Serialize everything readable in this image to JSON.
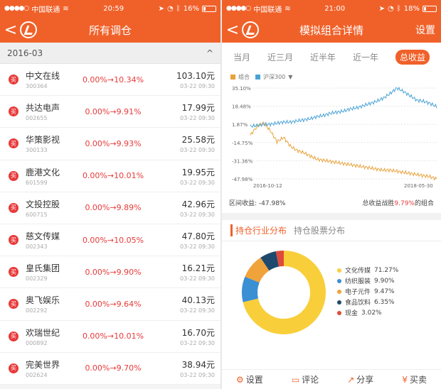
{
  "left": {
    "status": {
      "carrier": "中国联通",
      "time": "20:59",
      "battery": "16%",
      "battery_level": 0.16
    },
    "nav": {
      "title": "所有调仓",
      "back": "<"
    },
    "section": {
      "label": "2016-03",
      "toggle": "^"
    },
    "badge": "买",
    "rows": [
      {
        "name": "中文在线",
        "code": "300364",
        "change": "0.00%→10.34%",
        "price": "103.10元",
        "time": "03-22 09:30"
      },
      {
        "name": "共达电声",
        "code": "002655",
        "change": "0.00%→9.91%",
        "price": "17.99元",
        "time": "03-22 09:30"
      },
      {
        "name": "华策影视",
        "code": "300133",
        "change": "0.00%→9.93%",
        "price": "25.58元",
        "time": "03-22 09:30"
      },
      {
        "name": "鹿港文化",
        "code": "601599",
        "change": "0.00%→10.01%",
        "price": "19.95元",
        "time": "03-22 09:30"
      },
      {
        "name": "文投控股",
        "code": "600715",
        "change": "0.00%→9.89%",
        "price": "42.96元",
        "time": "03-22 09:30"
      },
      {
        "name": "慈文传媒",
        "code": "002343",
        "change": "0.00%→10.05%",
        "price": "47.80元",
        "time": "03-22 09:30"
      },
      {
        "name": "皇氏集团",
        "code": "002329",
        "change": "0.00%→9.90%",
        "price": "16.21元",
        "time": "03-22 09:30"
      },
      {
        "name": "奥飞娱乐",
        "code": "002292",
        "change": "0.00%→9.64%",
        "price": "40.13元",
        "time": "03-22 09:30"
      },
      {
        "name": "欢瑞世纪",
        "code": "000892",
        "change": "0.00%→10.01%",
        "price": "16.70元",
        "time": "03-22 09:30"
      },
      {
        "name": "完美世界",
        "code": "002624",
        "change": "0.00%→9.70%",
        "price": "38.94元",
        "time": "03-22 09:30"
      }
    ]
  },
  "right": {
    "status": {
      "carrier": "中国联通",
      "time": "21:00",
      "battery": "18%",
      "battery_level": 0.18
    },
    "nav": {
      "title": "模拟组合详情",
      "back": "<",
      "settings": "设置"
    },
    "period_tabs": [
      "当月",
      "近三月",
      "近半年",
      "近一年",
      "总收益"
    ],
    "legend": {
      "portfolio": "组合",
      "index": "沪深300",
      "arrow": "▼"
    },
    "summary": {
      "label": "区间收益:",
      "value": "-47.98%",
      "prefix": "总收益战胜",
      "pct": "9.79%",
      "suffix": "的组合"
    },
    "dist_tabs": [
      "持仓行业分布",
      "持仓股票分布"
    ],
    "bottom": [
      {
        "icon": "gear-icon",
        "glyph": "⚙",
        "label": "设置"
      },
      {
        "icon": "comment-icon",
        "glyph": "▭",
        "label": "评论"
      },
      {
        "icon": "share-icon",
        "glyph": "↗",
        "label": "分享"
      },
      {
        "icon": "yen-icon",
        "glyph": "¥",
        "label": "买卖"
      }
    ]
  },
  "chart_data": [
    {
      "type": "line",
      "y_ticks": [
        "35.10%",
        "18.48%",
        "1.87%",
        "-14.75%",
        "-31.36%",
        "-47.98%"
      ],
      "ylim": [
        -47.98,
        35.1
      ],
      "x_ticks": [
        "2016-10-12",
        "2018-05-30"
      ],
      "grid": true,
      "legend": "top-left",
      "series": [
        {
          "name": "组合",
          "color": "#e8a23c",
          "values": [
            -8,
            0,
            3,
            -4,
            -14,
            -10,
            -18,
            -22,
            -24,
            -27,
            -30,
            -31,
            -32,
            -33,
            -34,
            -35,
            -36,
            -37,
            -38,
            -39,
            -40,
            -40,
            -41,
            -42,
            -43,
            -44,
            -45,
            -46,
            -47.98
          ]
        },
        {
          "name": "沪深300",
          "color": "#4aa3d6",
          "values": [
            0,
            1,
            1.87,
            2,
            3,
            4,
            4,
            5,
            6,
            7,
            9,
            10,
            12,
            13,
            14,
            16,
            17,
            19,
            21,
            23,
            26,
            30,
            35.1,
            32,
            28,
            24,
            23,
            21,
            18
          ]
        }
      ]
    },
    {
      "type": "pie",
      "categories": [
        "文化传媒",
        "纺织服装",
        "电子元件",
        "食品饮料",
        "现金"
      ],
      "values": [
        71.27,
        9.9,
        9.47,
        6.35,
        3.02
      ],
      "labels": [
        "71.27%",
        "9.90%",
        "9.47%",
        "6.35%",
        "3.02%"
      ],
      "colors": [
        "#f8cf3a",
        "#3b8fd3",
        "#f0a33a",
        "#1f4a6e",
        "#e04a3a"
      ]
    }
  ]
}
